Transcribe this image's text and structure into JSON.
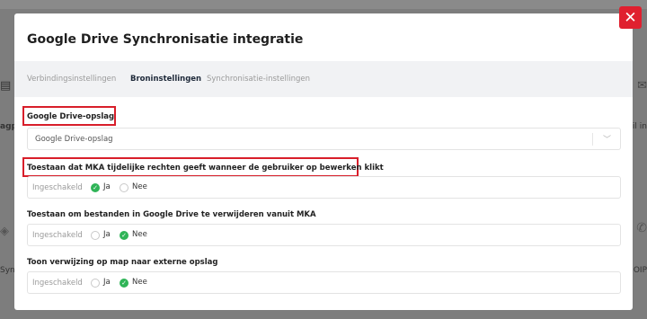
{
  "background": {
    "left_label_1": "agp",
    "left_label_2": "Syn",
    "right_label_1": "il in",
    "right_label_2": "OIP"
  },
  "modal": {
    "title": "Google Drive Synchronisatie integratie",
    "close_glyph": "✕",
    "tabs": [
      {
        "label": "Verbindingsinstellingen",
        "active": false
      },
      {
        "label": "Broninstellingen",
        "active": true
      },
      {
        "label": "Synchronisatie-instellingen",
        "active": false
      }
    ],
    "storage": {
      "label": "Google Drive-opslag",
      "selected": "Google Drive-opslag"
    },
    "settings": [
      {
        "label": "Toestaan dat MKA tijdelijke rechten geeft wanneer de gebruiker op bewerken klikt",
        "status": "Ingeschakeld",
        "yes": "Ja",
        "no": "Nee",
        "selected": "Ja"
      },
      {
        "label": "Toestaan om bestanden in Google Drive te verwijderen vanuit MKA",
        "status": "Ingeschakeld",
        "yes": "Ja",
        "no": "Nee",
        "selected": "Nee"
      },
      {
        "label": "Toon verwijzing op map naar externe opslag",
        "status": "Ingeschakeld",
        "yes": "Ja",
        "no": "Nee",
        "selected": "Nee"
      }
    ]
  },
  "colors": {
    "highlight": "#d81e2a",
    "close": "#e0202f",
    "check": "#2fb457"
  }
}
